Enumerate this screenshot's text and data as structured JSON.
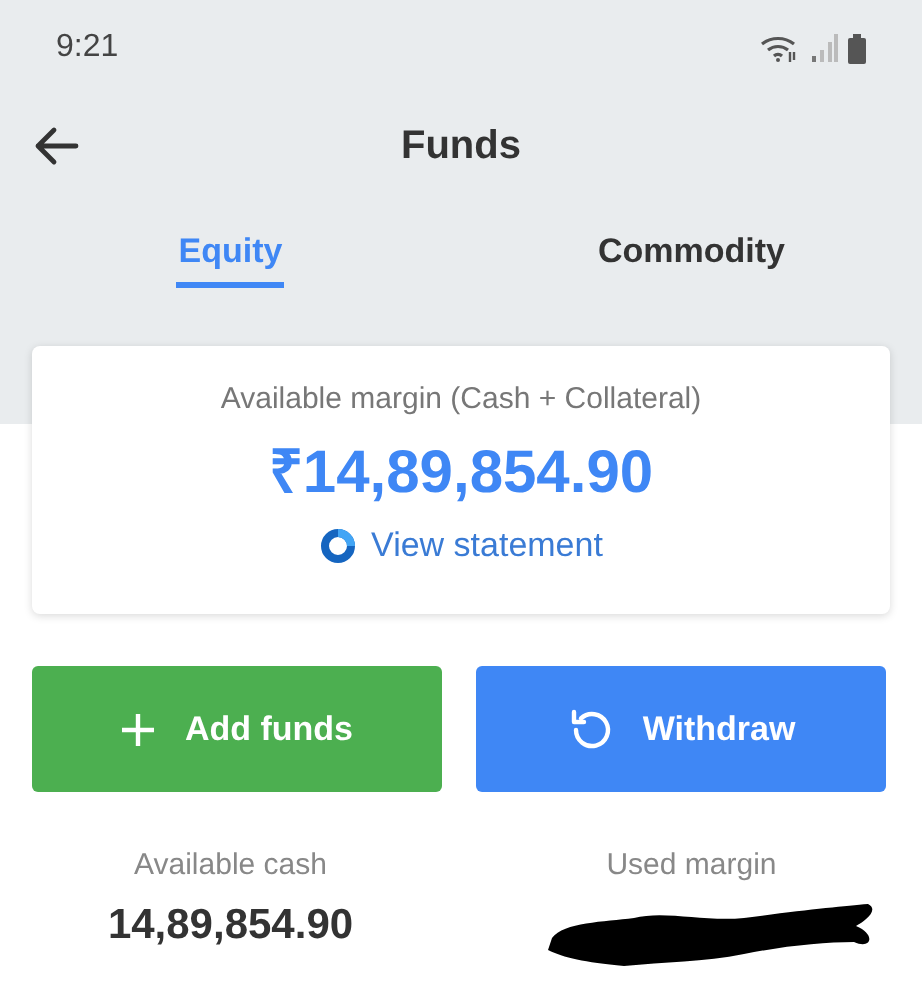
{
  "status_bar": {
    "time": "9:21"
  },
  "header": {
    "title": "Funds"
  },
  "tabs": [
    {
      "label": "Equity",
      "selected": true
    },
    {
      "label": "Commodity",
      "selected": false
    }
  ],
  "margin_card": {
    "label": "Available margin (Cash + Collateral)",
    "amount": "₹14,89,854.90",
    "link": "View statement"
  },
  "buttons": [
    {
      "kind": "add",
      "label": "Add funds"
    },
    {
      "kind": "withdraw",
      "label": "Withdraw"
    }
  ],
  "stats": [
    {
      "label": "Available cash",
      "value": "14,89,854.90",
      "redacted": false
    },
    {
      "label": "Used margin",
      "redacted": true
    }
  ]
}
